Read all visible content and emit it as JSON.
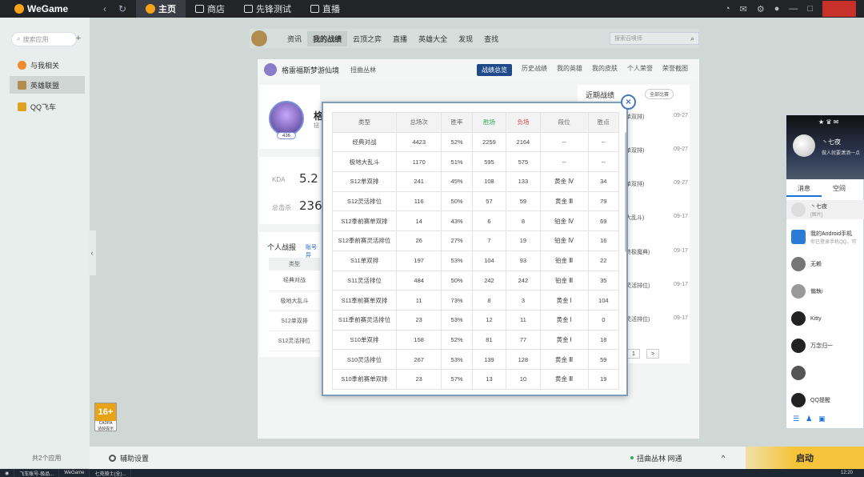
{
  "app": {
    "brand": "WeGame",
    "nav": [
      {
        "label": "主页",
        "icon": "home-icon",
        "active": true
      },
      {
        "label": "商店",
        "icon": "store-icon",
        "active": false
      },
      {
        "label": "先锋测试",
        "icon": "gamepad-icon",
        "active": false
      },
      {
        "label": "直播",
        "icon": "play-icon",
        "active": false
      }
    ]
  },
  "sidebar": {
    "search_placeholder": "搜索应用",
    "items": [
      {
        "label": "与我相关",
        "icon": "related-icon",
        "color": "#f08a2c"
      },
      {
        "label": "英雄联盟",
        "icon": "lol-icon",
        "color": "#b08d4f",
        "active": true
      },
      {
        "label": "QQ飞车",
        "icon": "qq-speed-icon",
        "color": "#e0a020"
      }
    ],
    "apps_count": "共2个应用",
    "age_rating": "16+",
    "age_sub": "CADPA",
    "age_note": "适龄提示"
  },
  "lol_nav": {
    "items": [
      "资讯",
      "我的战绩",
      "云顶之弈",
      "直播",
      "英雄大全",
      "发现",
      "查找"
    ],
    "active_index": 1,
    "search_placeholder": "搜索召唤师"
  },
  "subheader": {
    "summoner": "格雷福斯梦游仙境",
    "server": "扭曲丛林",
    "tabs": [
      "战绩总览",
      "历史战绩",
      "我的英雄",
      "我的皮肤",
      "个人荣誉",
      "荣誉截图"
    ],
    "active_tab": 0
  },
  "profile": {
    "level": "436",
    "name_partial": "格",
    "sub_partial": "扭"
  },
  "summary": {
    "kda_label": "KDA",
    "kda_value": "5.2",
    "kills_label": "总击杀",
    "kills_value": "236"
  },
  "personal": {
    "title": "个人战报",
    "account_link": "账号异",
    "col_header": "类型",
    "rows": [
      "经典对战",
      "极地大乱斗",
      "S12单双排",
      "S12灵活排位"
    ]
  },
  "recent": {
    "title": "近期战绩",
    "filter": "全部比赛",
    "rows": [
      {
        "mode": "单双排)",
        "date": "09-27"
      },
      {
        "mode": "单双排)",
        "date": "09-27"
      },
      {
        "mode": "单双排)",
        "date": "09-27"
      },
      {
        "mode": "大乱斗)",
        "date": "09-17"
      },
      {
        "mode": "终极魔典)",
        "date": "09-17"
      },
      {
        "mode": "灵活排位)",
        "date": "09-17"
      },
      {
        "mode": "灵活排位)",
        "date": "09-17"
      }
    ],
    "page": "1",
    "next": ">"
  },
  "dialog": {
    "headers": [
      "类型",
      "总场次",
      "胜率",
      "胜场",
      "负场",
      "段位",
      "胜点"
    ],
    "rows": [
      [
        "经典对战",
        "4423",
        "52%",
        "2259",
        "2164",
        "--",
        "--"
      ],
      [
        "极地大乱斗",
        "1170",
        "51%",
        "595",
        "575",
        "--",
        "--"
      ],
      [
        "S12单双排",
        "241",
        "45%",
        "108",
        "133",
        "黄金 Ⅳ",
        "34"
      ],
      [
        "S12灵活排位",
        "116",
        "50%",
        "57",
        "59",
        "黄金 Ⅲ",
        "79"
      ],
      [
        "S12季前赛单双排",
        "14",
        "43%",
        "6",
        "8",
        "铂金 Ⅳ",
        "69"
      ],
      [
        "S12季前赛灵活排位",
        "26",
        "27%",
        "7",
        "19",
        "铂金 Ⅳ",
        "16"
      ],
      [
        "S11单双排",
        "197",
        "53%",
        "104",
        "93",
        "铂金 Ⅲ",
        "22"
      ],
      [
        "S11灵活排位",
        "484",
        "50%",
        "242",
        "242",
        "铂金 Ⅲ",
        "35"
      ],
      [
        "S11季前赛单双排",
        "11",
        "73%",
        "8",
        "3",
        "黄金 Ⅰ",
        "104"
      ],
      [
        "S11季前赛灵活排位",
        "23",
        "53%",
        "12",
        "11",
        "黄金 Ⅰ",
        "0"
      ],
      [
        "S10单双排",
        "158",
        "52%",
        "81",
        "77",
        "黄金 Ⅰ",
        "18"
      ],
      [
        "S10灵活排位",
        "267",
        "53%",
        "139",
        "128",
        "黄金 Ⅲ",
        "59"
      ],
      [
        "S10季前赛单双排",
        "23",
        "57%",
        "13",
        "10",
        "黄金 Ⅲ",
        "19"
      ]
    ],
    "close": "×"
  },
  "bottom": {
    "settings": "辅助设置",
    "server": "扭曲丛林 网通",
    "expand": "^",
    "start": "启动"
  },
  "taskbar": {
    "items": [
      "飞车账号-极品...",
      "WeGame",
      "七壳骑士(全)..."
    ],
    "clock": "12:20"
  },
  "qq": {
    "nickname": "丶七夜",
    "signature": "做人就要潇洒一点",
    "tabs": [
      "消息",
      "空间"
    ],
    "contacts": [
      {
        "name": "丶七夜",
        "status": "[图片]"
      },
      {
        "name": "我的Android手机",
        "status": "你已登录手机QQ，可"
      },
      {
        "name": "无赖",
        "status": ""
      },
      {
        "name": "偏執i",
        "status": ""
      },
      {
        "name": "Kitty",
        "status": ""
      },
      {
        "name": "万念归一",
        "status": ""
      },
      {
        "name": "",
        "status": ""
      },
      {
        "name": "QQ提醒",
        "status": ""
      }
    ]
  },
  "colors": {
    "accent": "#f7a21b",
    "win_button": "#1f4a8a",
    "loss": "#e0464a",
    "close": "#c8312a",
    "qq_blue": "#1e6fd6"
  }
}
